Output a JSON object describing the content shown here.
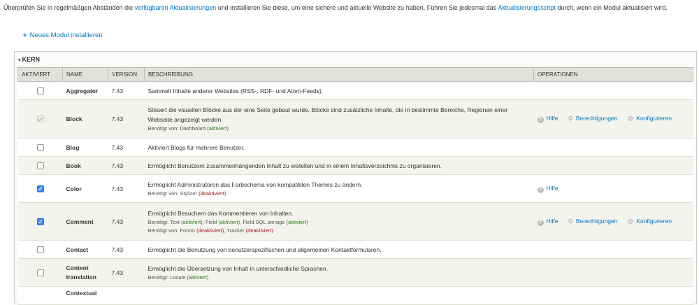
{
  "intro": {
    "part1": "Überprüfen Sie in regelmäßgen Abständen die ",
    "link1": "verfügbaren Aktualisierungen",
    "part2": " und installieren Sie diese, um eine sichere und aktuelle Website zu haben. Führen Sie jedesmal das ",
    "link2": "Aktualisierungsscript",
    "part3": " durch, wenn ein Modul aktualisiert wird."
  },
  "new_module": {
    "plus": "+",
    "label": "Neues Modul installieren"
  },
  "fieldset": {
    "toggle": "▾",
    "legend": "KERN"
  },
  "table": {
    "headers": {
      "enabled": "AKTIVIERT",
      "name": "NAME",
      "version": "VERSION",
      "description": "BESCHREIBUNG",
      "operations": "OPERATIONEN"
    },
    "rows": [
      {
        "name": "Aggregator",
        "version": "7.43",
        "checked": false,
        "disabled": false,
        "description": "Sammelt Inhalte anderer Websites (RSS-, RDF- und Atom-Feeds)."
      },
      {
        "name": "Block",
        "version": "7.43",
        "checked": true,
        "disabled": true,
        "description": "Steuert die visuellen Blöcke aus der eine Seite gebaut wurde. Blöcke sind zusätzliche Inhalte, die in bestimmte Bereiche, Regionen einer Webseite angezeigt werden.",
        "req_label": "Benötigt von: ",
        "req_item": "Dashboard",
        "req_status": "(aktiviert)"
      },
      {
        "name": "Blog",
        "version": "7.43",
        "checked": false,
        "disabled": false,
        "description": "Aktiviert Blogs für mehrere Benutzer."
      },
      {
        "name": "Book",
        "version": "7.43",
        "checked": false,
        "disabled": false,
        "description": "Ermöglicht Benutzern zusammenhängenden Inhalt zu erstellen und in einem Inhaltsverzeichnis zu organisieren."
      },
      {
        "name": "Color",
        "version": "7.43",
        "checked": true,
        "disabled": false,
        "description": "Ermöglicht Administratoren das Farbschema von kompatiblen Themes zu ändern.",
        "req_label": "Benötigt von: ",
        "req_item": "Stylizer",
        "req_status": "(deaktiviert)"
      },
      {
        "name": "Comment",
        "version": "7.43",
        "checked": true,
        "disabled": false,
        "description": "Ermöglicht Besuchern das Kommentieren von Inhalten.",
        "dep_label": "Benötigt: ",
        "dep1": "Text",
        "dep1_status": "(aktiviert)",
        "dep2": "Field",
        "dep2_status": "(aktiviert)",
        "dep3": "Field SQL storage",
        "dep3_status": "(aktiviert)",
        "req_label": "Benötigt von: ",
        "req1": "Forum",
        "req1_status": "(deaktiviert)",
        "req2": "Tracker",
        "req2_status": "(deaktiviert)"
      },
      {
        "name": "Contact",
        "version": "7.43",
        "checked": false,
        "disabled": false,
        "description": "Ermöglicht die Benutzung von benutzerspezifischen und allgemeinen Kontaktformularen."
      },
      {
        "name_line1": "Content",
        "name_line2": "translation",
        "version": "7.43",
        "checked": false,
        "disabled": false,
        "description": "Ermöglicht die Übersetzung von Inhalt in unterschiedliche Sprachen.",
        "dep_label": "Benötigt: ",
        "dep_item": "Locale",
        "dep_status": "(aktiviert)"
      },
      {
        "name": "Contextual",
        "version": "",
        "checked": false,
        "disabled": false,
        "description": ""
      }
    ],
    "ops": {
      "help": "Hilfe",
      "permissions": "Berechtigungen",
      "configure": "Konfigurieren"
    }
  },
  "icons": {
    "help": "help-icon",
    "permissions": "key-icon",
    "configure": "gear-icon"
  },
  "colors": {
    "link": "#0074bd",
    "header_bg": "#e1e2dc",
    "even_row": "#f3f4ee",
    "enabled": "#2b7a1a",
    "disabled": "#a01b1b"
  }
}
